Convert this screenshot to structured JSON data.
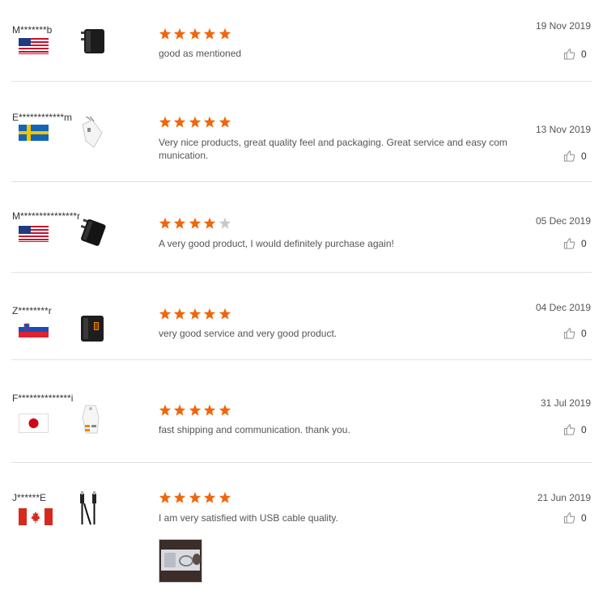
{
  "colors": {
    "star_on": "#f0660c",
    "star_off": "#c9c9c9",
    "divider": "#e2e2e2"
  },
  "reviews": [
    {
      "user": "M*******b",
      "country": "us",
      "product_icon": "wall-charger-icon",
      "stars": 5,
      "text": "good as mentioned",
      "date": "19 Nov 2019",
      "likes": "0"
    },
    {
      "user": "E************m",
      "country": "se",
      "product_icon": "white-charger-icon",
      "stars": 5,
      "text": "Very nice products, great quality feel and packaging. Great service and easy com munication.",
      "date": "13 Nov 2019",
      "likes": "0"
    },
    {
      "user": "M***************r",
      "country": "us",
      "product_icon": "wall-charger-icon",
      "stars": 4,
      "text": "A very good product, I would definitely purchase again!",
      "date": "05 Dec 2019",
      "likes": "0"
    },
    {
      "user": "Z********r",
      "country": "si",
      "product_icon": "quick-charger-icon",
      "stars": 5,
      "text": "very good service and very good product.",
      "date": "04 Dec 2019",
      "likes": "0"
    },
    {
      "user": "F**************i",
      "country": "jp",
      "product_icon": "car-charger-icon",
      "stars": 5,
      "text": "fast shipping and communication. thank you.",
      "date": "31 Jul 2019",
      "likes": "0"
    },
    {
      "user": "J******E",
      "country": "ca",
      "product_icon": "usb-cable-icon",
      "stars": 5,
      "text": "I am very satisfied with USB cable quality.",
      "date": "21 Jun 2019",
      "likes": "0"
    }
  ]
}
